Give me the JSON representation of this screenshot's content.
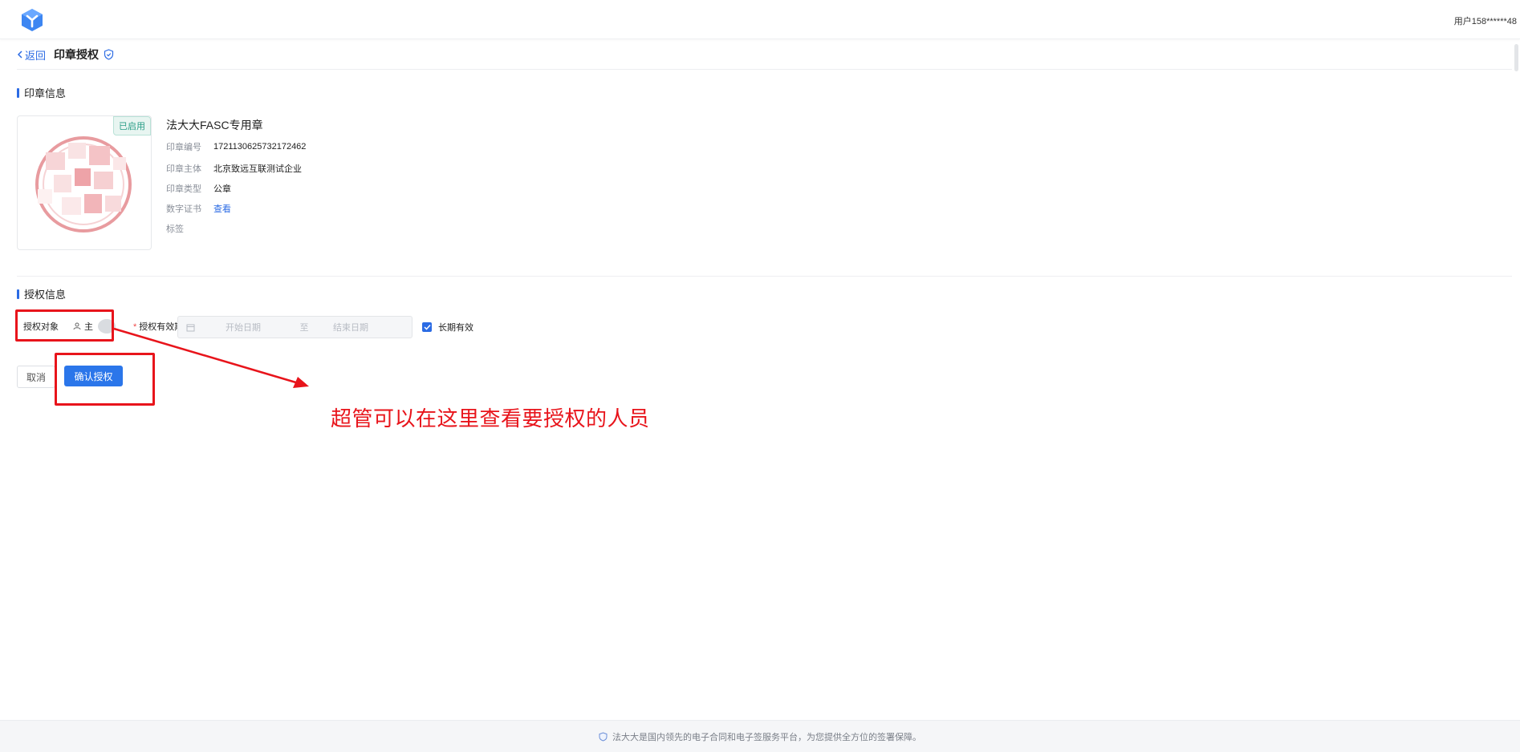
{
  "topbar": {
    "user_label": "用户158******48"
  },
  "header": {
    "back_label": "返回",
    "title": "印章授权"
  },
  "seal_section": {
    "title": "印章信息"
  },
  "seal": {
    "status_badge": "已启用",
    "name": "法大大FASC专用章",
    "rows": [
      {
        "label": "印章编号",
        "value": "1721130625732172462"
      },
      {
        "label": "印章主体",
        "value": "北京致远互联测试企业"
      },
      {
        "label": "印章类型",
        "value": "公章"
      },
      {
        "label": "数字证书",
        "value": "查看"
      },
      {
        "label": "标签",
        "value": ""
      }
    ]
  },
  "auth_section": {
    "title": "授权信息"
  },
  "form": {
    "target_label": "授权对象",
    "target_value": "主",
    "period_label": "授权有效期",
    "start_placeholder": "开始日期",
    "range_separator": "至",
    "end_placeholder": "结束日期",
    "long_term_label": "长期有效",
    "long_term_checked": true
  },
  "actions": {
    "cancel_label": "取消",
    "confirm_label": "确认授权"
  },
  "annotation": {
    "text": "超管可以在这里查看要授权的人员",
    "color": "#e8141b"
  },
  "footer": {
    "text": "法大大是国内领先的电子合同和电子签服务平台，为您提供全方位的签署保障。"
  },
  "colors": {
    "accent": "#2b6be4",
    "annotation": "#e8141b",
    "badge_green": "#2a9d86"
  }
}
